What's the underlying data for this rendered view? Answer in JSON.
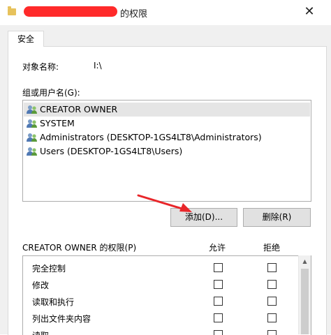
{
  "window": {
    "title_suffix": "的权限",
    "close_glyph": "✕"
  },
  "tab": {
    "label": "安全"
  },
  "object": {
    "label": "对象名称:",
    "value": "I:\\"
  },
  "groups": {
    "label": "组或用户名(G):",
    "items": [
      {
        "name": "CREATOR OWNER"
      },
      {
        "name": "SYSTEM"
      },
      {
        "name": "Administrators (DESKTOP-1GS4LT8\\Administrators)"
      },
      {
        "name": "Users (DESKTOP-1GS4LT8\\Users)"
      }
    ],
    "selected_index": 0
  },
  "buttons": {
    "add": "添加(D)...",
    "remove": "删除(R)"
  },
  "permissions": {
    "label": "CREATOR OWNER 的权限(P)",
    "allow_label": "允许",
    "deny_label": "拒绝",
    "rows": [
      {
        "name": "完全控制"
      },
      {
        "name": "修改"
      },
      {
        "name": "读取和执行"
      },
      {
        "name": "列出文件夹内容"
      },
      {
        "name": "读取"
      }
    ]
  },
  "colors": {
    "annotation_arrow": "#e8262a",
    "redaction": "#ff2a2a"
  },
  "icons": {
    "title": "folder-icon",
    "user": "user-group-icon",
    "arrow": "annotation-arrow",
    "scroll": "scroll-up-arrow-icon"
  }
}
